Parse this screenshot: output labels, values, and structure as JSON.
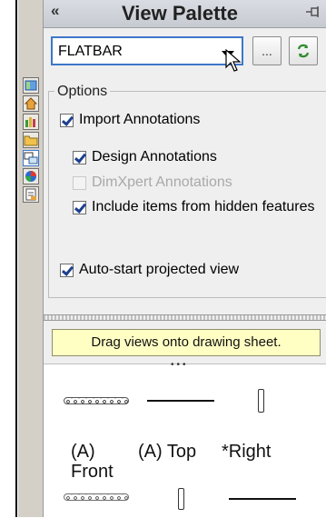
{
  "panel": {
    "collapse_glyph": "«",
    "title": "View Palette"
  },
  "document_select": {
    "value": "FLATBAR",
    "browse_label": "...",
    "refresh_icon": "refresh-icon"
  },
  "options": {
    "group_title": "Options",
    "import_annotations": {
      "label": "Import Annotations",
      "checked": true
    },
    "design_annotations": {
      "label": "Design Annotations",
      "checked": true
    },
    "dimxpert_annotations": {
      "label": "DimXpert Annotations",
      "checked": false,
      "enabled": false
    },
    "include_hidden": {
      "label": "Include items from hidden features",
      "checked": true
    },
    "auto_start": {
      "label": "Auto-start projected view",
      "checked": true
    }
  },
  "hint_text": "Drag views onto drawing sheet.",
  "views": [
    {
      "label": "(A)\nFront"
    },
    {
      "label": "(A) Top"
    },
    {
      "label": "*Right"
    }
  ],
  "tabs": [
    "task-pane-icon",
    "home-icon",
    "library-icon",
    "folder-icon",
    "view-palette-icon",
    "appearance-icon",
    "properties-icon"
  ],
  "colors": {
    "accent": "#3e77c9",
    "hint_bg": "#ffffc4",
    "check": "#1c3f8f"
  }
}
